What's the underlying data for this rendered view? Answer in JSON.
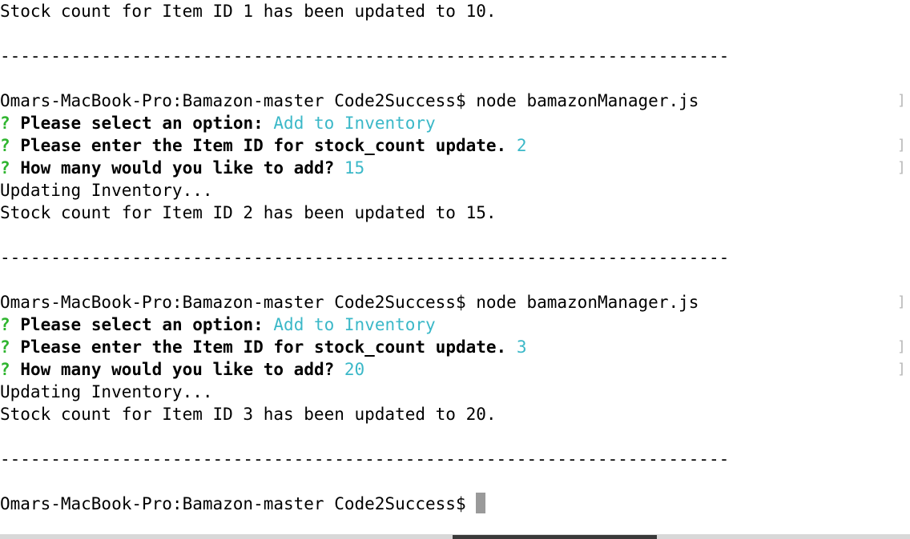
{
  "terminal": {
    "prompt": "Omars-MacBook-Pro:Bamazon-master Code2Success$",
    "command": "node bamazonManager.js",
    "question_mark": "?",
    "q_select": "Please select an option:",
    "q_item_id": "Please enter the Item ID for stock_count update.",
    "q_how_many": "How many would you like to add?",
    "updating": "Updating Inventory...",
    "separator": "------------------------------------------------------------------------",
    "cursor_icon": "block-cursor",
    "bracket_glyph": "]",
    "colors": {
      "answer": "#3bb8c8",
      "question_mark": "#2fb52f",
      "text": "#000000",
      "cursor": "#9a9a9a"
    },
    "first_result": "Stock count for Item ID 1 has been updated to 10.",
    "sessions": [
      {
        "option": "Add to Inventory",
        "item_id": "2",
        "quantity": "15",
        "result": "Stock count for Item ID 2 has been updated to 15."
      },
      {
        "option": "Add to Inventory",
        "item_id": "3",
        "quantity": "20",
        "result": "Stock count for Item ID 3 has been updated to 20."
      }
    ]
  }
}
